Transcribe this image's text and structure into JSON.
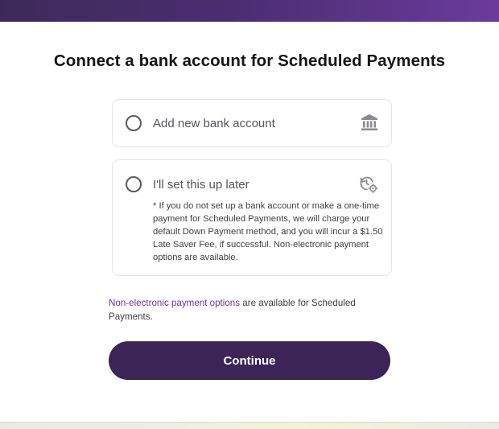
{
  "header": {
    "title": "Connect a bank account for Scheduled Payments"
  },
  "options": [
    {
      "label": "Add new bank account",
      "icon": "bank-icon",
      "selected": false
    },
    {
      "label": "I'll set this up later",
      "icon": "clock-settings-icon",
      "selected": false,
      "note": "* If you do not set up a bank account or make a one-time payment for Scheduled Payments, we will charge your default Down Payment method, and you will incur a $1.50 Late Saver Fee, if successful. Non-electronic payment options are available."
    }
  ],
  "footer": {
    "link_text": "Non-electronic payment options",
    "text": " are available for Scheduled Payments."
  },
  "actions": {
    "continue_label": "Continue"
  },
  "colors": {
    "brand_dark": "#3c2456",
    "link": "#6b2fb3",
    "header_gradient_start": "#3e2a5a",
    "header_gradient_end": "#6a3b9c"
  }
}
